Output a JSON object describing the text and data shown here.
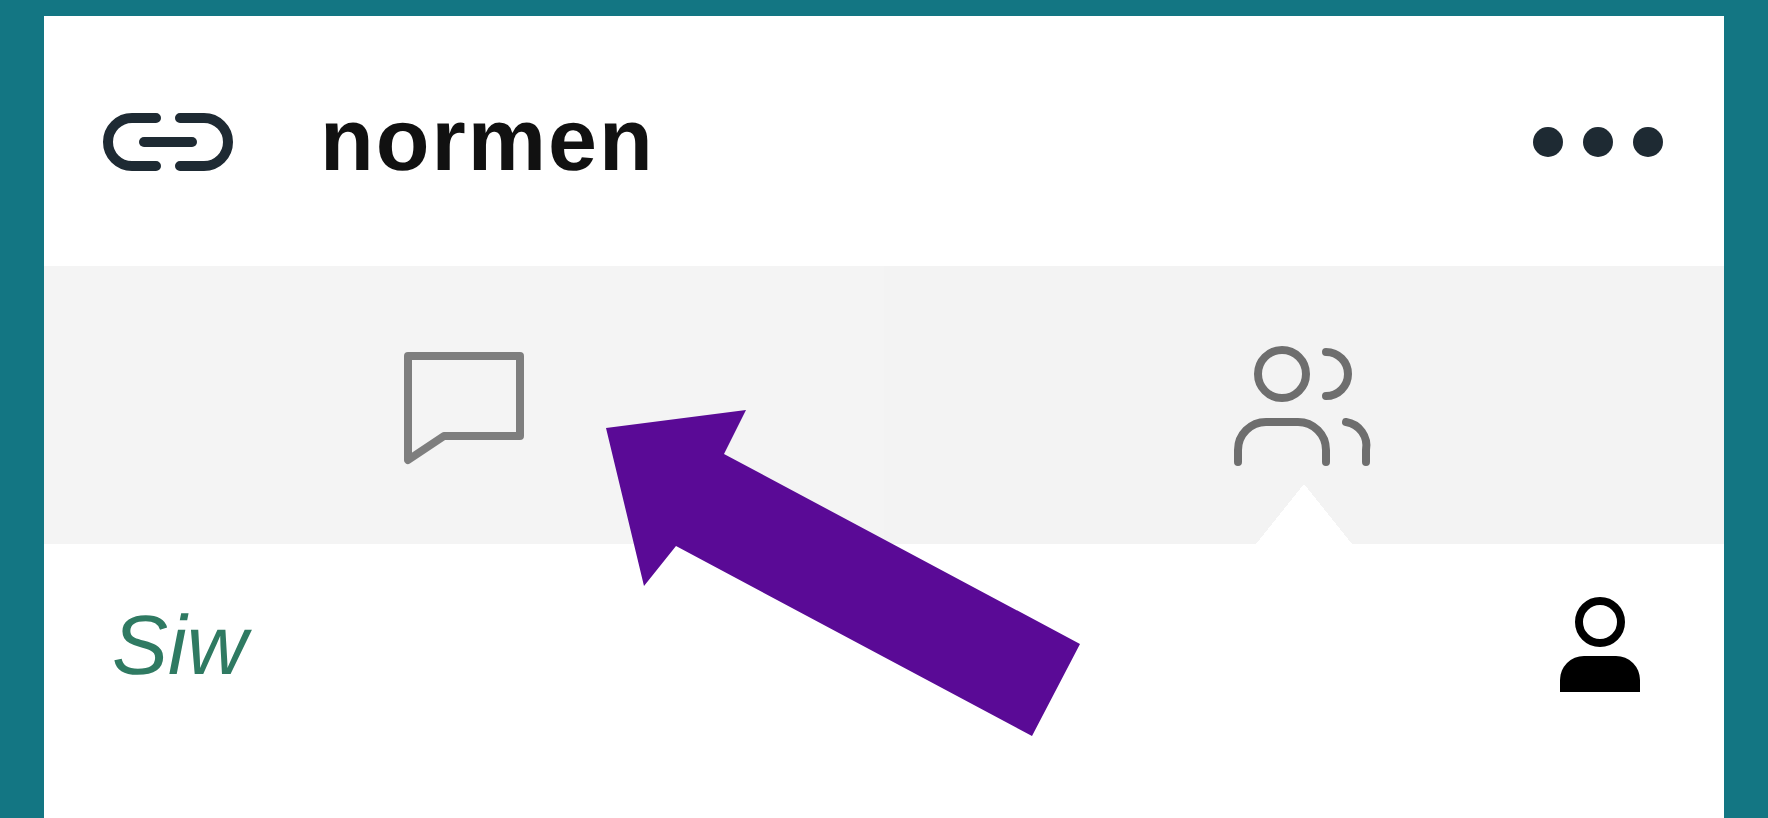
{
  "header": {
    "title": "normen"
  },
  "tabs": [
    {
      "kind": "chat",
      "selected": false
    },
    {
      "kind": "people",
      "selected": true
    }
  ],
  "members": [
    {
      "name": "Siw"
    }
  ]
}
